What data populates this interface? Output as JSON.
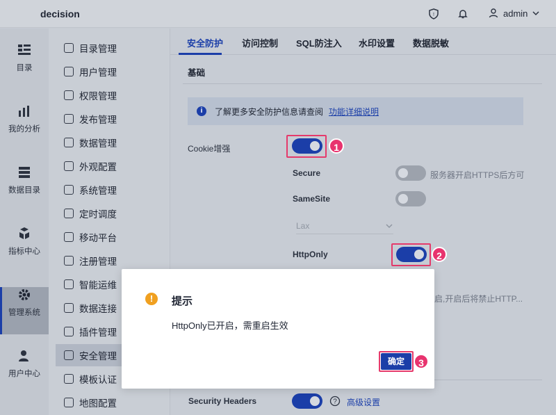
{
  "app": {
    "title": "decision",
    "user": "admin"
  },
  "rail": [
    {
      "label": "目录"
    },
    {
      "label": "我的分析"
    },
    {
      "label": "数据目录"
    },
    {
      "label": "指标中心"
    },
    {
      "label": "管理系统"
    },
    {
      "label": "用户中心"
    }
  ],
  "submenu": [
    {
      "label": "目录管理"
    },
    {
      "label": "用户管理"
    },
    {
      "label": "权限管理"
    },
    {
      "label": "发布管理"
    },
    {
      "label": "数据管理"
    },
    {
      "label": "外观配置"
    },
    {
      "label": "系统管理"
    },
    {
      "label": "定时调度"
    },
    {
      "label": "移动平台"
    },
    {
      "label": "注册管理"
    },
    {
      "label": "智能运维"
    },
    {
      "label": "数据连接"
    },
    {
      "label": "插件管理"
    },
    {
      "label": "安全管理"
    },
    {
      "label": "模板认证"
    },
    {
      "label": "地图配置"
    }
  ],
  "tabs": [
    {
      "label": "安全防护"
    },
    {
      "label": "访问控制"
    },
    {
      "label": "SQL防注入"
    },
    {
      "label": "水印设置"
    },
    {
      "label": "数据脱敏"
    }
  ],
  "section": {
    "title": "基础"
  },
  "info": {
    "text": "了解更多安全防护信息请查阅",
    "link": "功能详细说明"
  },
  "settings": {
    "cookie": {
      "label": "Cookie增强",
      "on": true
    },
    "secure": {
      "label": "Secure",
      "hint": "服务器开启HTTPS后方可",
      "on": false
    },
    "samesite": {
      "label": "SameSite",
      "on": false,
      "value": "Lax"
    },
    "httponly": {
      "label": "HttpOnly",
      "on": true
    },
    "hidden_hint": "启,开启后将禁止HTTP...",
    "security_headers": {
      "label": "Security Headers",
      "on": true,
      "link": "高级设置"
    }
  },
  "badges": [
    "1",
    "2",
    "3"
  ],
  "dialog": {
    "title": "提示",
    "message": "HttpOnly已开启，需重启生效",
    "confirm": "确定"
  },
  "colors": {
    "accent": "#1b3ea8",
    "badge": "#e8336e",
    "warning": "#f0a020"
  }
}
